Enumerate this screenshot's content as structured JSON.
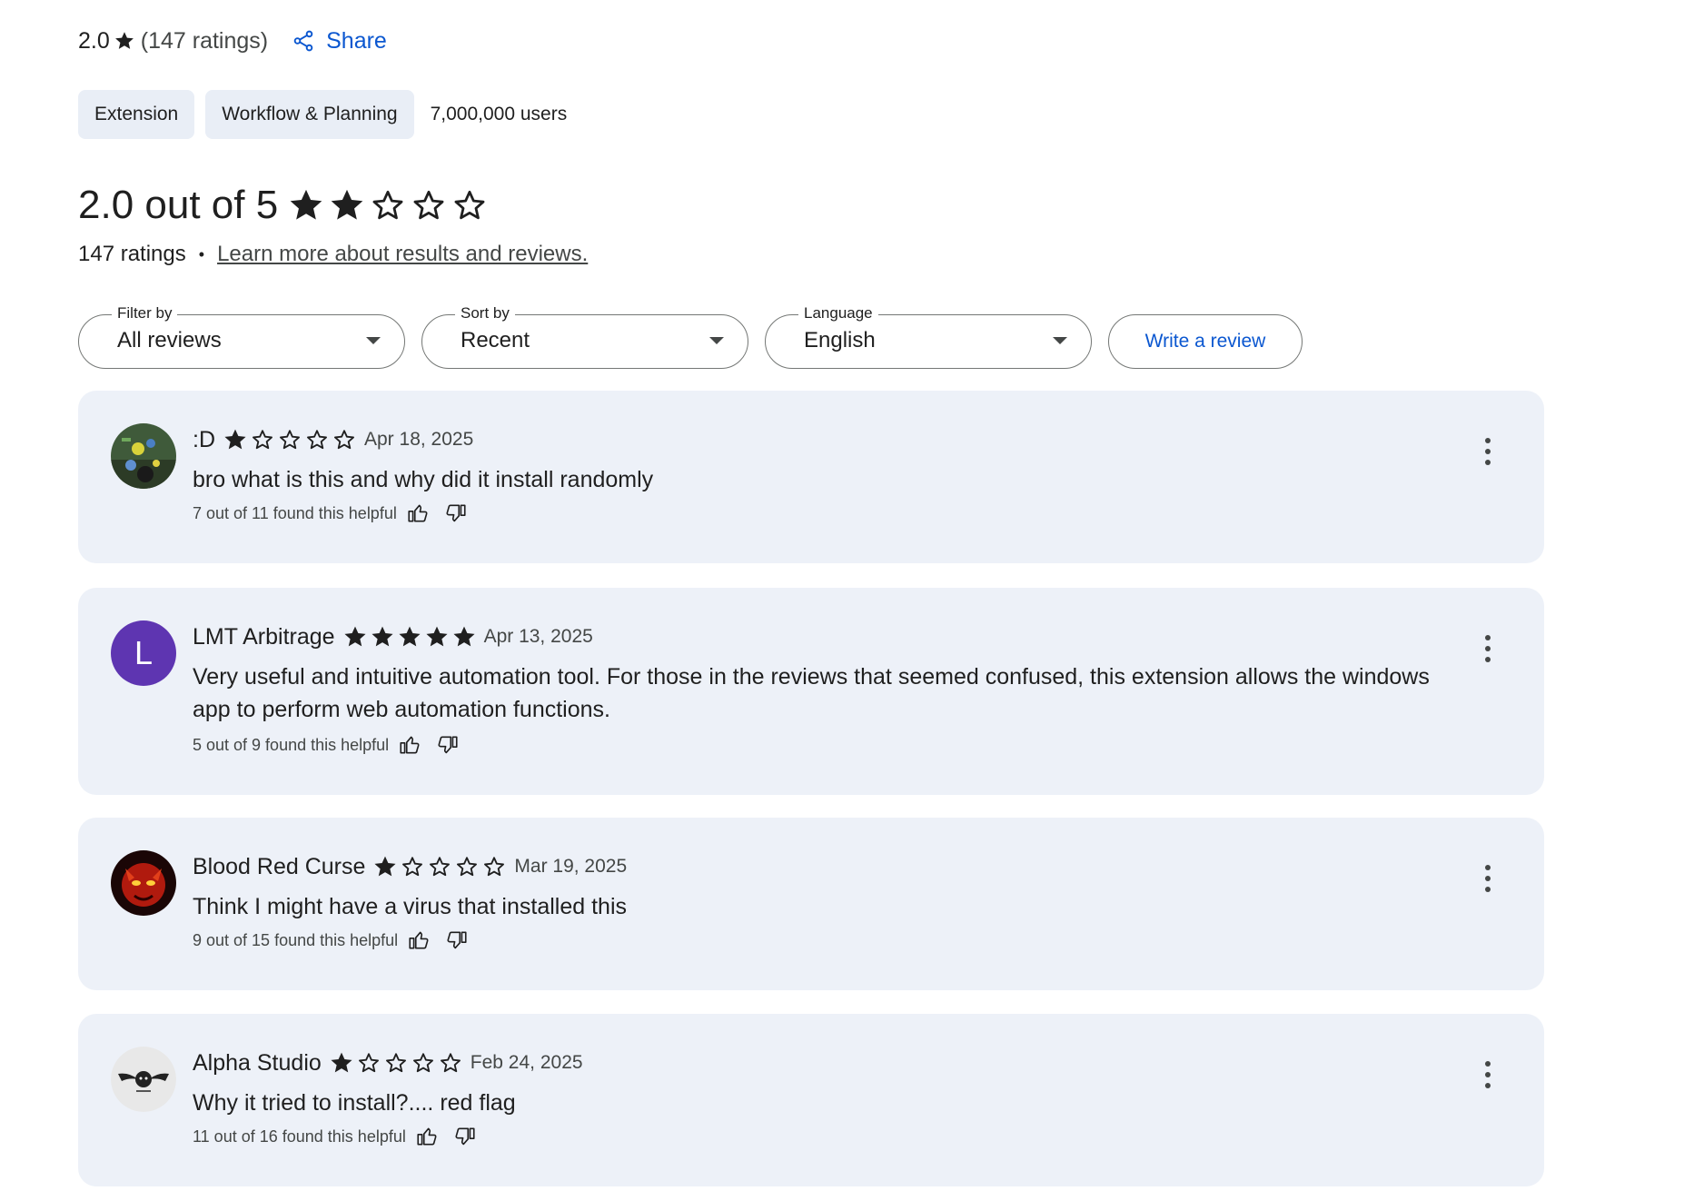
{
  "summary": {
    "rating": "2.0",
    "count": "(147 ratings)",
    "share_label": "Share"
  },
  "chips": {
    "type": "Extension",
    "category": "Workflow & Planning",
    "users": "7,000,000 users"
  },
  "rating_overview": {
    "headline": "2.0 out of 5",
    "stars_filled": 2,
    "stars_total": 5,
    "ratings_count": "147 ratings",
    "separator": "•",
    "learn_more": "Learn more about results and reviews."
  },
  "filters": {
    "filter_label": "Filter by",
    "filter_value": "All reviews",
    "sort_label": "Sort by",
    "sort_value": "Recent",
    "language_label": "Language",
    "language_value": "English",
    "write_review": "Write a review"
  },
  "reviews": [
    {
      "author": ":D",
      "stars": 1,
      "date": "Apr 18, 2025",
      "text": "bro what is this and why did it install randomly",
      "helpful": "7 out of 11 found this helpful",
      "avatar": "game-screenshot-avatar"
    },
    {
      "author": "LMT Arbitrage",
      "stars": 5,
      "date": "Apr 13, 2025",
      "text": "Very useful and intuitive automation tool. For those in the reviews that seemed confused, this extension allows the windows app to perform web automation functions.",
      "helpful": "5 out of 9 found this helpful",
      "avatar_letter": "L",
      "avatar_color": "#5e35b1"
    },
    {
      "author": "Blood Red Curse",
      "stars": 1,
      "date": "Mar 19, 2025",
      "text": "Think I might have a virus that installed this",
      "helpful": "9 out of 15 found this helpful",
      "avatar": "red-demon-avatar"
    },
    {
      "author": "Alpha Studio",
      "stars": 1,
      "date": "Feb 24, 2025",
      "text": "Why it tried to install?.... red flag",
      "helpful": "11 out of 16 found this helpful",
      "avatar": "winged-lion-logo-avatar"
    }
  ],
  "colors": {
    "accent": "#0b57d0",
    "card_bg": "#edf1f8",
    "chip_bg": "#e9eef6"
  }
}
